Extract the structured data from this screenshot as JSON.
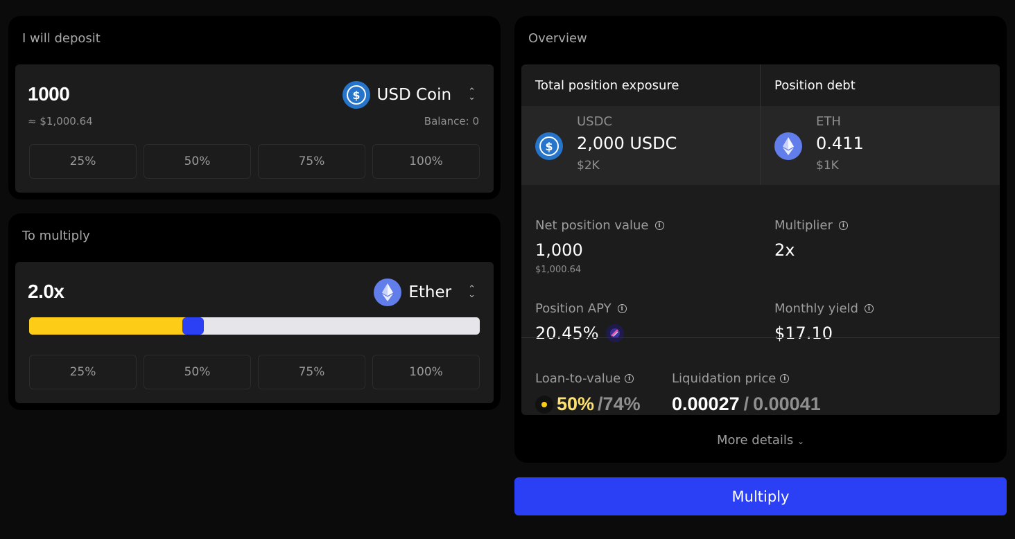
{
  "deposit": {
    "title": "I will deposit",
    "amount": "1000",
    "usd_value": "≈ $1,000.64",
    "token": "USD Coin",
    "token_icon": "usdc-icon",
    "balance": "Balance: 0",
    "percent_buttons": [
      "25%",
      "50%",
      "75%",
      "100%"
    ]
  },
  "multiply": {
    "title": "To multiply",
    "multiplier": "2.0x",
    "token": "Ether",
    "token_icon": "eth-icon",
    "slider_fraction": 0.35,
    "percent_buttons": [
      "25%",
      "50%",
      "75%",
      "100%"
    ]
  },
  "overview": {
    "title": "Overview",
    "exposure_header": "Total position exposure",
    "debt_header": "Position debt",
    "exposure": {
      "symbol": "USDC",
      "amount": "2,000 USDC",
      "usd": "$2K"
    },
    "debt": {
      "symbol": "ETH",
      "amount": "0.411",
      "usd": "$1K"
    },
    "net_value": {
      "label": "Net position value",
      "value": "1,000",
      "sub": "$1,000.64"
    },
    "multiplier": {
      "label": "Multiplier",
      "value": "2x"
    },
    "apy": {
      "label": "Position APY",
      "value": "20.45%"
    },
    "monthly_yield": {
      "label": "Monthly yield",
      "value": "$17.10"
    },
    "ltv": {
      "label": "Loan-to-value",
      "current": "50%",
      "max": "/74%"
    },
    "liquidation": {
      "label": "Liquidation price",
      "current": "0.00027",
      "separator": "/",
      "max": "0.00041"
    },
    "more_details": "More details"
  },
  "action": {
    "label": "Multiply"
  },
  "colors": {
    "accent_blue": "#2b3ff5",
    "accent_yellow": "#fccc16",
    "usdc_blue": "#2775ca",
    "eth_purple": "#627eea"
  }
}
